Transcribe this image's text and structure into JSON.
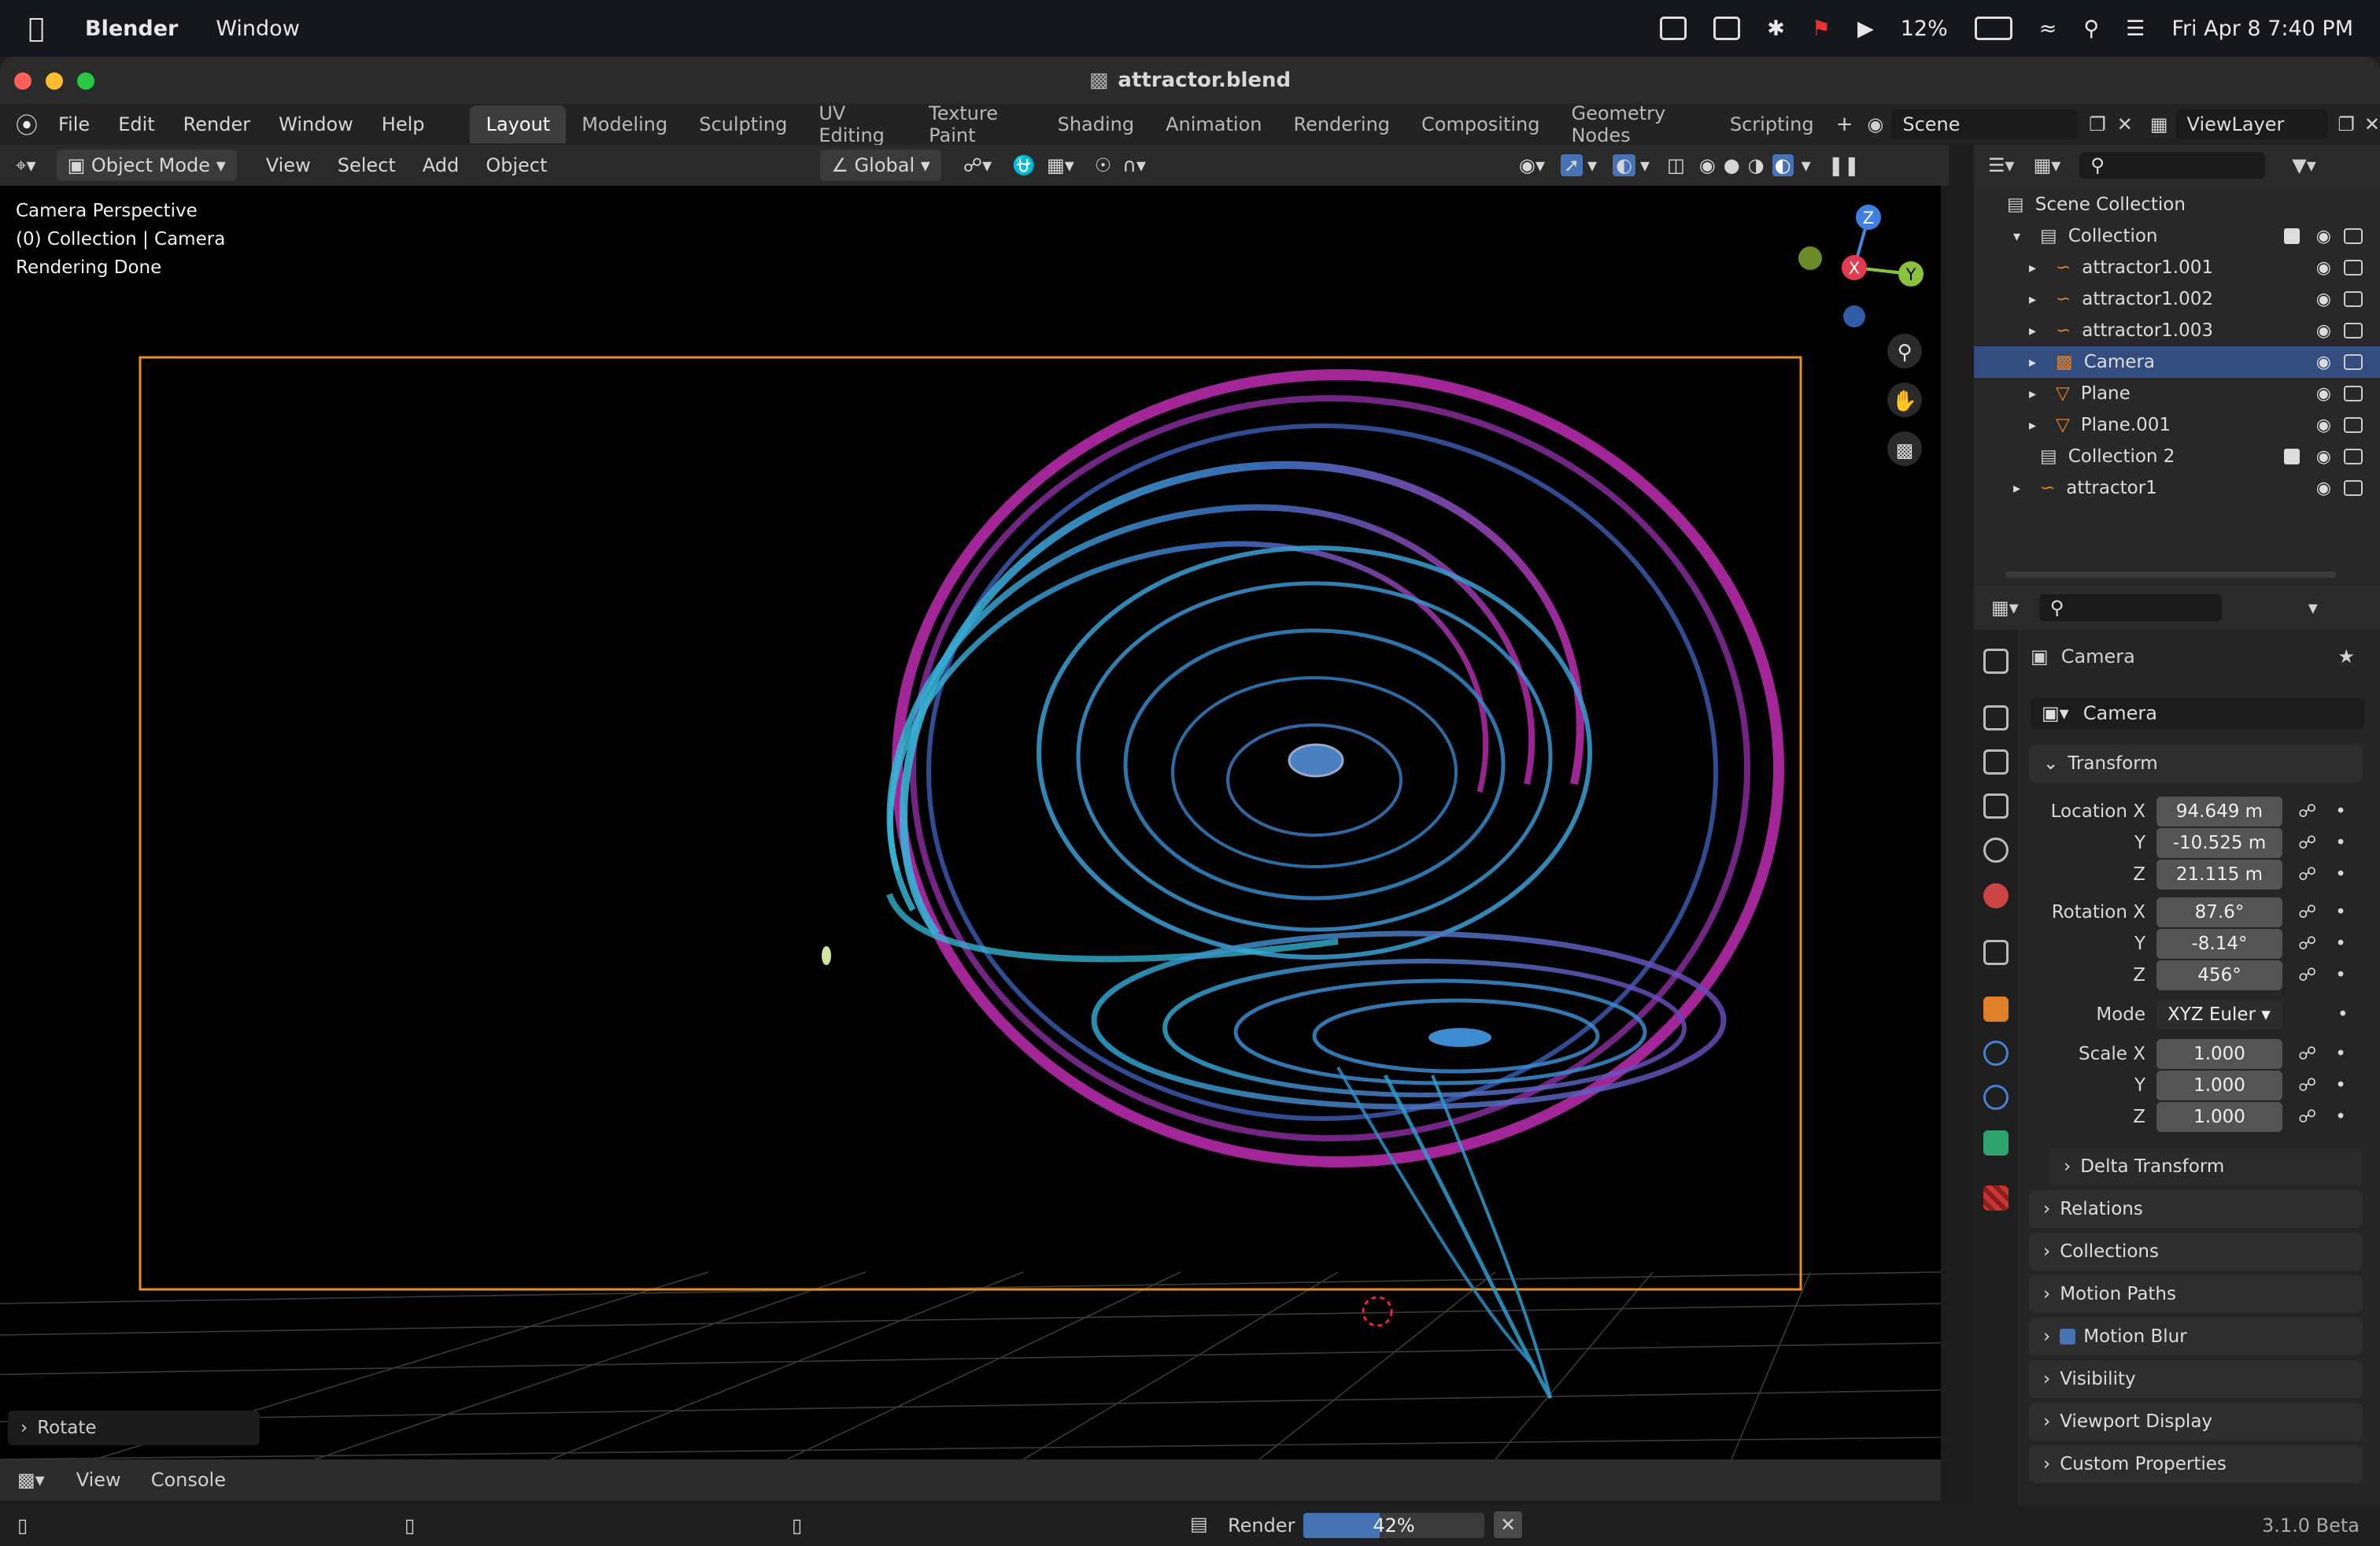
{
  "macos": {
    "app_name": "Blender",
    "menu": [
      "Window"
    ],
    "battery": "12%",
    "datetime": "Fri Apr 8  7:40 PM"
  },
  "window": {
    "title": "attractor.blend"
  },
  "topbar": {
    "menus": [
      "File",
      "Edit",
      "Render",
      "Window",
      "Help"
    ],
    "workspaces": [
      "Layout",
      "Modeling",
      "Sculpting",
      "UV Editing",
      "Texture Paint",
      "Shading",
      "Animation",
      "Rendering",
      "Compositing",
      "Geometry Nodes",
      "Scripting"
    ],
    "active_workspace": "Layout",
    "scene": "Scene",
    "view_layer": "ViewLayer"
  },
  "viewport_header": {
    "mode": "Object Mode",
    "menus": [
      "View",
      "Select",
      "Add",
      "Object"
    ],
    "transform_orientation": "Global"
  },
  "viewport": {
    "overlay_lines": [
      "Camera Perspective",
      "(0) Collection | Camera",
      "Rendering Done"
    ],
    "gizmo_axes": [
      "Z",
      "X",
      "Y"
    ],
    "last_operator": "Rotate"
  },
  "outliner": {
    "root": "Scene Collection",
    "rows": [
      {
        "label": "Collection",
        "indent": 1,
        "type": "collection",
        "selected": false
      },
      {
        "label": "attractor1.001",
        "indent": 2,
        "type": "curve",
        "selected": false
      },
      {
        "label": "attractor1.002",
        "indent": 2,
        "type": "curve",
        "selected": false
      },
      {
        "label": "attractor1.003",
        "indent": 2,
        "type": "curve",
        "selected": false
      },
      {
        "label": "Camera",
        "indent": 2,
        "type": "camera",
        "selected": true
      },
      {
        "label": "Plane",
        "indent": 2,
        "type": "mesh",
        "selected": false
      },
      {
        "label": "Plane.001",
        "indent": 2,
        "type": "mesh",
        "selected": false
      },
      {
        "label": "Collection 2",
        "indent": 1,
        "type": "collection",
        "selected": false
      },
      {
        "label": "attractor1",
        "indent": 1,
        "type": "curve",
        "selected": false
      }
    ]
  },
  "properties": {
    "object_name": "Camera",
    "data_name": "Camera",
    "transform_title": "Transform",
    "location": {
      "label": "Location X",
      "x": "94.649 m",
      "y": "-10.525 m",
      "z": "21.115 m"
    },
    "rotation": {
      "label": "Rotation X",
      "x": "87.6°",
      "y": "-8.14°",
      "z": "456°"
    },
    "mode_label": "Mode",
    "mode_value": "XYZ Euler",
    "scale": {
      "label": "Scale X",
      "x": "1.000",
      "y": "1.000",
      "z": "1.000"
    },
    "axis_y": "Y",
    "axis_z": "Z",
    "delta": "Delta Transform",
    "panels": [
      "Relations",
      "Collections",
      "Motion Paths",
      "Motion Blur",
      "Visibility",
      "Viewport Display",
      "Custom Properties"
    ]
  },
  "console": {
    "menus": [
      "View",
      "Console"
    ]
  },
  "status": {
    "render_label": "Render",
    "progress_percent": 42,
    "progress_text": "42%",
    "version": "3.1.0 Beta"
  },
  "colors": {
    "accent": "#4772b3",
    "selection": "#334d80",
    "camera_frame": "#e8901c",
    "strand_cyan": "#35b6d6",
    "strand_magenta": "#b52aa8"
  }
}
